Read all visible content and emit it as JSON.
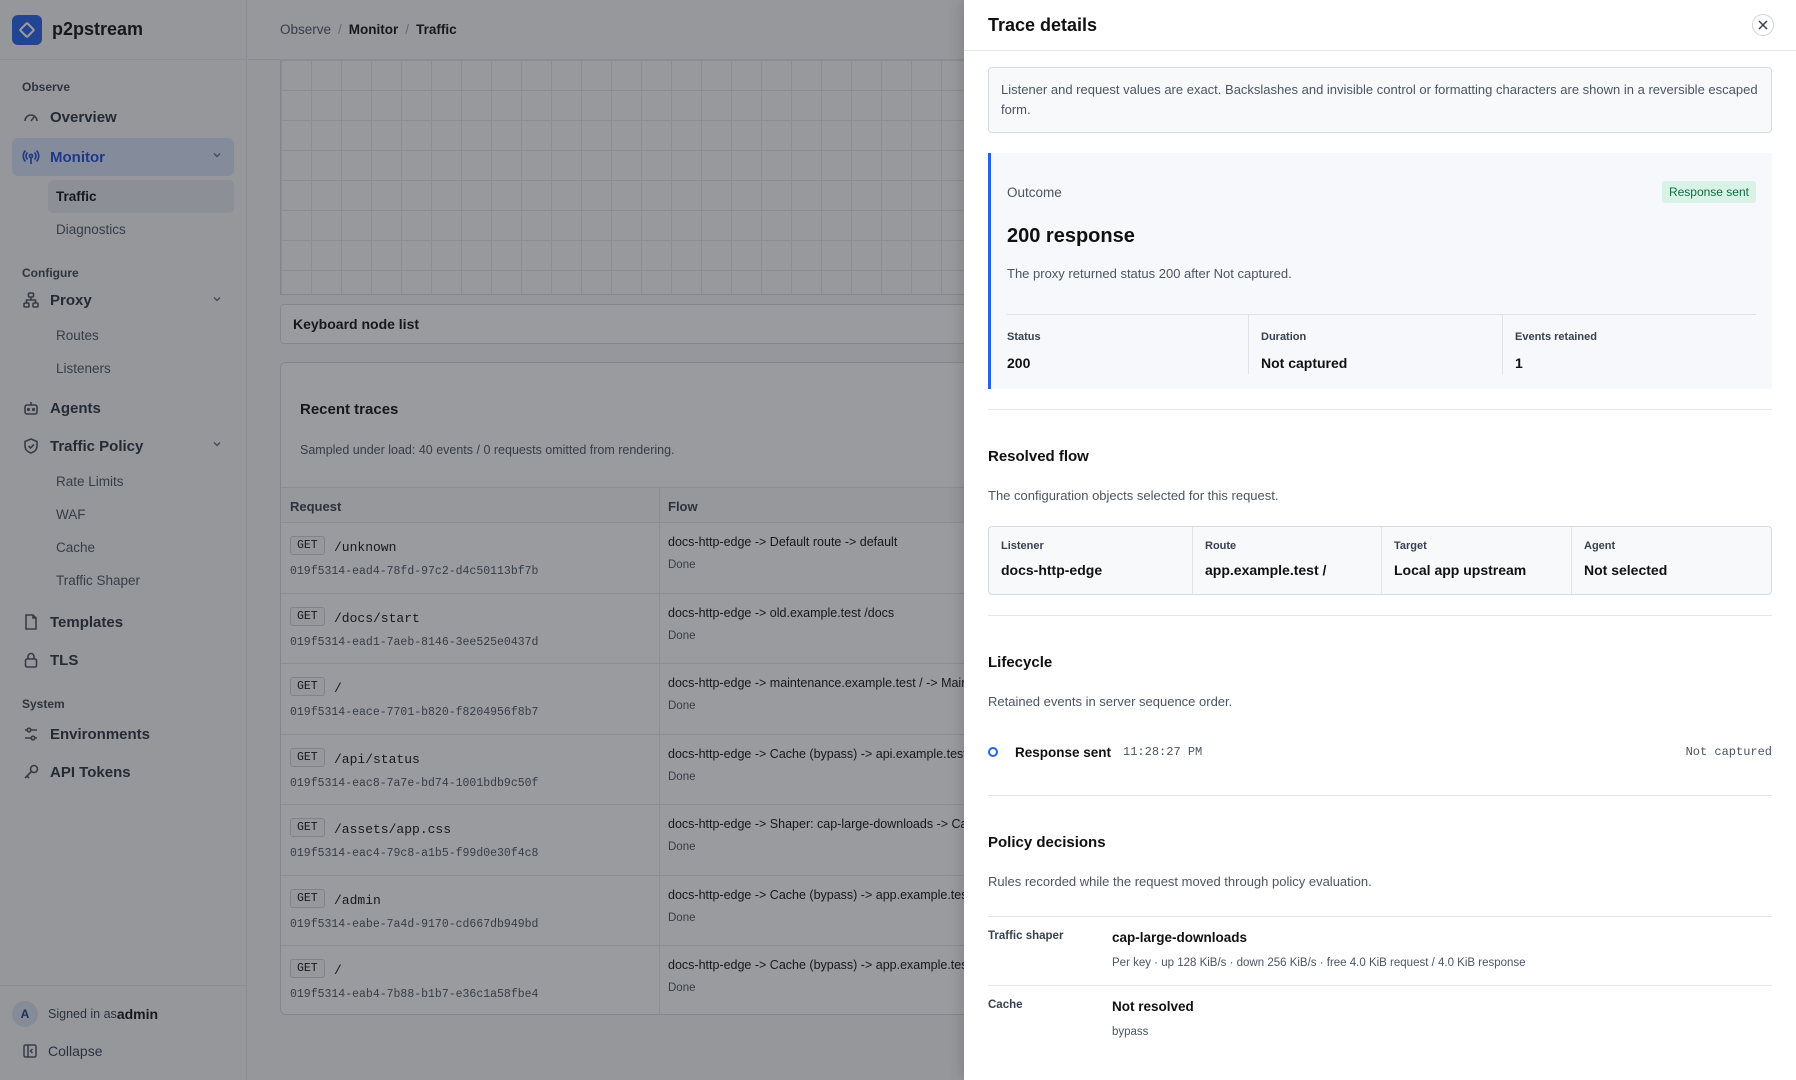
{
  "app": {
    "name": "p2pstream"
  },
  "breadcrumb": {
    "items": [
      "Observe",
      "Monitor",
      "Traffic"
    ]
  },
  "sidebar": {
    "sections": {
      "observe": "Observe",
      "configure": "Configure",
      "system": "System"
    },
    "items": {
      "overview": "Overview",
      "monitor": "Monitor",
      "traffic": "Traffic",
      "diagnostics": "Diagnostics",
      "proxy": "Proxy",
      "routes": "Routes",
      "listeners": "Listeners",
      "agents": "Agents",
      "traffic_policy": "Traffic Policy",
      "rate_limits": "Rate Limits",
      "waf": "WAF",
      "cache": "Cache",
      "traffic_shaper": "Traffic Shaper",
      "templates": "Templates",
      "tls": "TLS",
      "environments": "Environments",
      "api_tokens": "API Tokens"
    },
    "footer": {
      "avatar_letter": "A",
      "signed_in_prefix": "Signed in as",
      "user": "admin",
      "collapse": "Collapse"
    }
  },
  "main": {
    "keyboard_node_list": "Keyboard node list",
    "traces": {
      "title": "Recent traces",
      "note": "Sampled under load: 40 events / 0 requests omitted from rendering.",
      "columns": [
        "Request",
        "Flow"
      ],
      "rows": [
        {
          "method": "GET",
          "path": "/unknown",
          "id": "019f5314-ead4-78fd-97c2-d4c50113bf7b",
          "flow": "docs-http-edge -> Default route -> default",
          "state": "Done"
        },
        {
          "method": "GET",
          "path": "/docs/start",
          "id": "019f5314-ead1-7aeb-8146-3ee525e0437d",
          "flow": "docs-http-edge -> old.example.test /docs",
          "state": "Done"
        },
        {
          "method": "GET",
          "path": "/",
          "id": "019f5314-eace-7701-b820-f8204956f8b7",
          "flow": "docs-http-edge -> maintenance.example.test / -> Main",
          "state": "Done"
        },
        {
          "method": "GET",
          "path": "/api/status",
          "id": "019f5314-eac8-7a7e-bd74-1001bdb9c50f",
          "flow": "docs-http-edge -> Cache (bypass) -> api.example.test /",
          "state": "Done"
        },
        {
          "method": "GET",
          "path": "/assets/app.css",
          "id": "019f5314-eac4-79c8-a1b5-f99d0e30f4c8",
          "flow": "docs-http-edge -> Shaper: cap-large-downloads -> Cac",
          "state": "Done"
        },
        {
          "method": "GET",
          "path": "/admin",
          "id": "019f5314-eabe-7a4d-9170-cd667db949bd",
          "flow": "docs-http-edge -> Cache (bypass) -> app.example.test",
          "state": "Done"
        },
        {
          "method": "GET",
          "path": "/",
          "id": "019f5314-eab4-7b88-b1b7-e36c1a58fbe4",
          "flow": "docs-http-edge -> Cache (bypass) -> app.example.test",
          "state": "Done"
        }
      ]
    }
  },
  "drawer": {
    "title": "Trace details",
    "notice": "Listener and request values are exact. Backslashes and invisible control or formatting characters are shown in a reversible escaped form.",
    "outcome": {
      "label": "Outcome",
      "badge": "Response sent",
      "headline": "200 response",
      "description": "The proxy returned status 200 after Not captured.",
      "stats": [
        {
          "label": "Status",
          "value": "200"
        },
        {
          "label": "Duration",
          "value": "Not captured"
        },
        {
          "label": "Events retained",
          "value": "1"
        }
      ]
    },
    "resolved_flow": {
      "title": "Resolved flow",
      "subtitle": "The configuration objects selected for this request.",
      "cells": [
        {
          "label": "Listener",
          "value": "docs-http-edge"
        },
        {
          "label": "Route",
          "value": "app.example.test /"
        },
        {
          "label": "Target",
          "value": "Local app upstream"
        },
        {
          "label": "Agent",
          "value": "Not selected"
        }
      ]
    },
    "lifecycle": {
      "title": "Lifecycle",
      "subtitle": "Retained events in server sequence order.",
      "event": {
        "name": "Response sent",
        "time": "11:28:27 PM",
        "right": "Not captured"
      }
    },
    "policy": {
      "title": "Policy decisions",
      "subtitle": "Rules recorded while the request moved through policy evaluation.",
      "rows": [
        {
          "label": "Traffic shaper",
          "value": "cap-large-downloads",
          "detail": "Per key · up 128 KiB/s · down 256 KiB/s · free 4.0 KiB request / 4.0 KiB response"
        },
        {
          "label": "Cache",
          "value": "Not resolved",
          "detail": "bypass"
        }
      ]
    }
  },
  "colors": {
    "accent": "#2563eb",
    "badge_bg": "#d9f2e6",
    "badge_fg": "#116b43"
  }
}
